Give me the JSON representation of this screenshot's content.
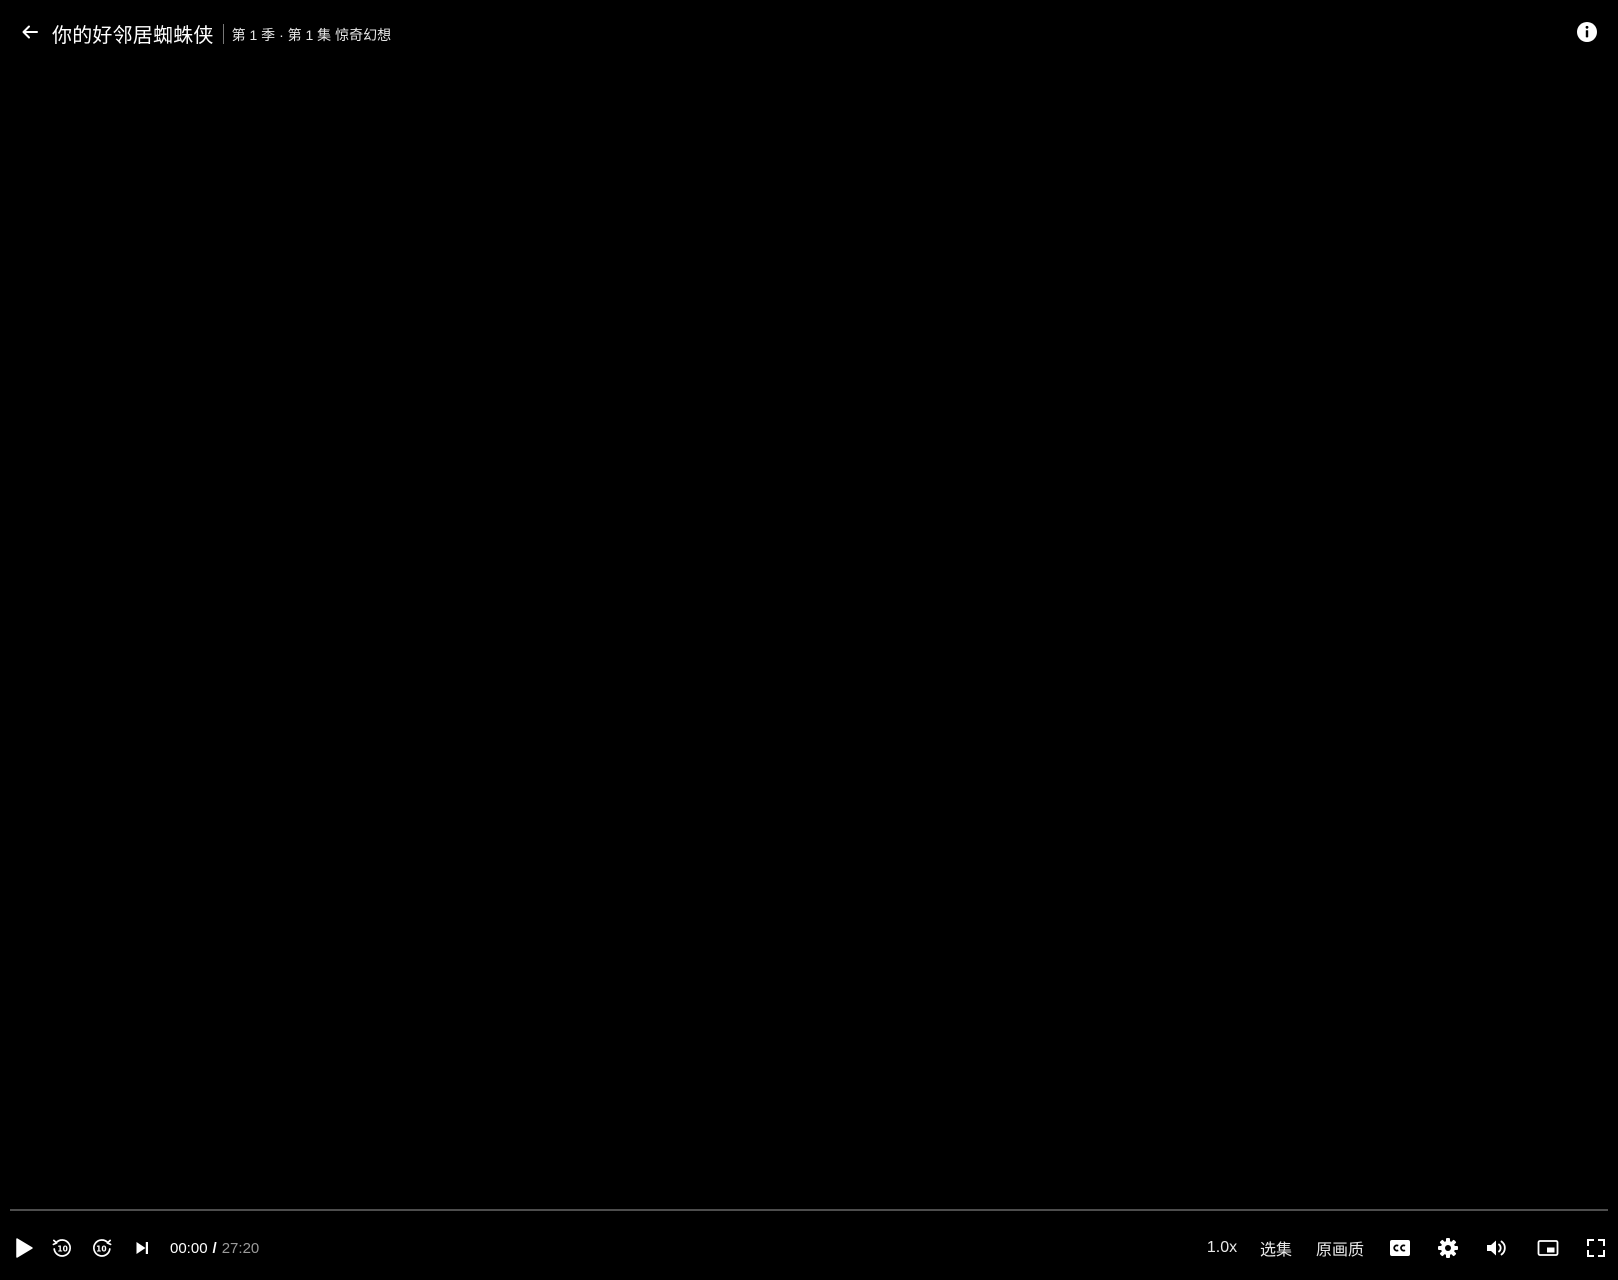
{
  "header": {
    "back_icon": "arrow-left-icon",
    "title": "你的好邻居蜘蛛侠",
    "episode": "第 1 季 · 第 1 集 惊奇幻想",
    "info_icon": "info-circle-icon"
  },
  "playback": {
    "progress": 0,
    "current_time": "00:00",
    "separator": "/",
    "total_time": "27:20"
  },
  "controls": {
    "play_icon": "play-icon",
    "rewind_icon": "rewind-10-icon",
    "forward_icon": "forward-10-icon",
    "next_icon": "skip-next-icon",
    "speed_label": "1.0x",
    "episodes_label": "选集",
    "quality_label": "原画质",
    "subtitles_icon": "cc-icon",
    "settings_icon": "gear-icon",
    "volume_icon": "volume-icon",
    "pip_icon": "picture-in-picture-icon",
    "fullscreen_icon": "fullscreen-icon"
  },
  "colors": {
    "background": "#000000",
    "text": "#ffffff",
    "muted_text": "#9a9a9a",
    "progress_track": "#4d4d4d"
  }
}
